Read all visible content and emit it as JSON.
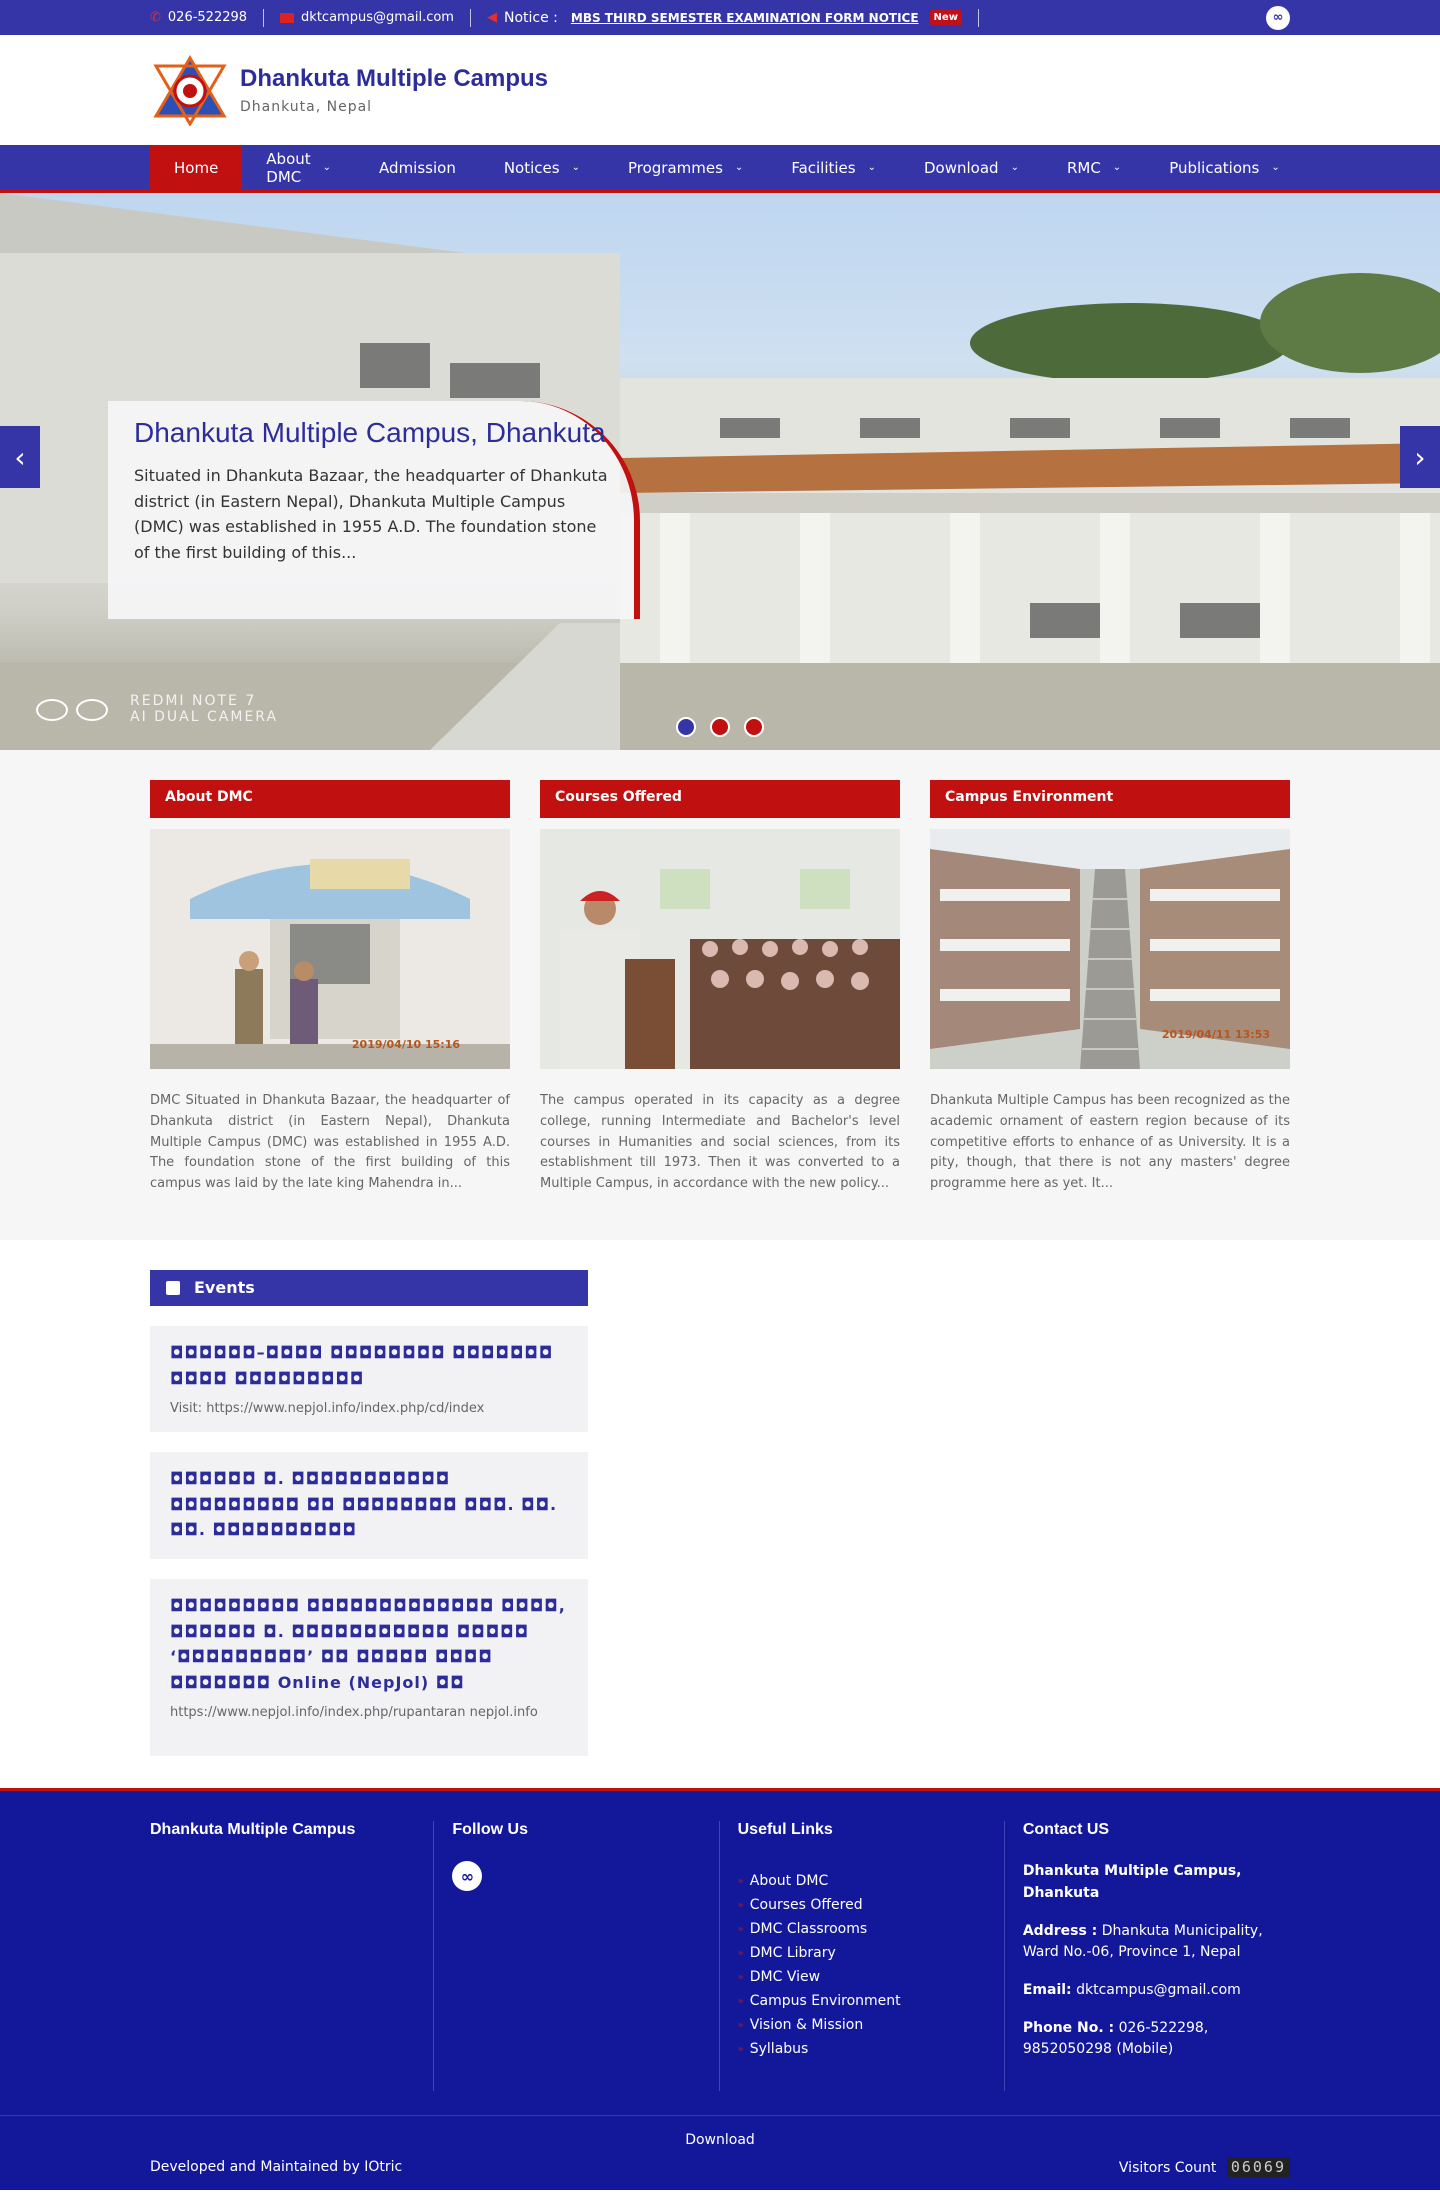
{
  "topbar": {
    "phone": "026-522298",
    "email": "dktcampus@gmail.com",
    "notice_label": "Notice :",
    "notice_text": "MBS THIRD SEMESTER EXAMINATION FORM NOTICE",
    "new_badge": "New"
  },
  "header": {
    "title": "Dhankuta Multiple Campus",
    "subtitle": "Dhankuta, Nepal"
  },
  "nav": {
    "items": [
      {
        "label": "Home"
      },
      {
        "label": "About DMC"
      },
      {
        "label": "Admission"
      },
      {
        "label": "Notices"
      },
      {
        "label": "Programmes"
      },
      {
        "label": "Facilities"
      },
      {
        "label": "Download"
      },
      {
        "label": "RMC"
      },
      {
        "label": "Publications"
      }
    ]
  },
  "slider": {
    "title": "Dhankuta Multiple Campus, Dhankuta",
    "text": "Situated in Dhankuta Bazaar, the headquarter of Dhankuta district (in Eastern Nepal), Dhankuta Multiple Campus (DMC) was established in 1955 A.D. The foundation stone of the first building of this...",
    "watermark_line1": "REDMI NOTE 7",
    "watermark_line2": "AI DUAL CAMERA"
  },
  "cards": [
    {
      "heading": "About DMC",
      "text": "DMC Situated in Dhankuta Bazaar, the headquarter of Dhankuta district (in Eastern Nepal), Dhankuta Multiple Campus (DMC) was established in 1955 A.D. The foundation stone of the first building of this campus was laid by the late king Mahendra in...",
      "stamp": "2019/04/10  15:16"
    },
    {
      "heading": "Courses Offered",
      "text": "The campus operated in its capacity as a degree college, running Intermediate and Bachelor's level courses in Humanities and social sciences, from its establishment till 1973. Then it was converted to a Multiple Campus, in accordance with the new policy...",
      "stamp": ""
    },
    {
      "heading": "Campus Environment",
      "text": "Dhankuta Multiple Campus has been recognized as the academic ornament of eastern region because of its competitive efforts to enhance of as University. It is a pity, though, that there is not any masters' degree programme here as yet. It...",
      "stamp": "2019/04/11  13:53"
    }
  ],
  "events": {
    "heading": "Events",
    "items": [
      {
        "title": "◘◘◘◘◘◘–◘◘◘◘ ◘◘◘◘◘◘◘◘ ◘◘◘◘◘◘◘ ◘◘◘◘ ◘◘◘◘◘◘◘◘◘",
        "text": "Visit: https://www.nepjol.info/index.php/cd/index"
      },
      {
        "title": "◘◘◘◘◘◘ ◘. ◘◘◘◘◘◘◘◘◘◘◘ ◘◘◘◘◘◘◘◘◘ ◘◘ ◘◘◘◘◘◘◘◘ ◘◘◘. ◘◘. ◘◘. ◘◘◘◘◘◘◘◘◘◘",
        "text": ""
      },
      {
        "title": "◘◘◘◘◘◘◘◘◘ ◘◘◘◘◘◘◘◘◘◘◘◘◘ ◘◘◘◘, ◘◘◘◘◘◘ ◘. ◘◘◘◘◘◘◘◘◘◘◘ ◘◘◘◘◘ ‘◘◘◘◘◘◘◘◘◘’ ◘◘ ◘◘◘◘◘ ◘◘◘◘ ◘◘◘◘◘◘◘ Online (NepJol) ◘◘",
        "text": "https://www.nepjol.info/index.php/rupantaran   nepjol.info"
      }
    ]
  },
  "footer": {
    "col1_head": "Dhankuta Multiple Campus",
    "col2_head": "Follow Us",
    "col3_head": "Useful Links",
    "col4_head": "Contact US",
    "links": [
      "About DMC",
      "Courses Offered",
      "DMC Classrooms",
      "DMC Library",
      "DMC View",
      "Campus Environment",
      "Vision & Mission",
      "Syllabus"
    ],
    "contact_name": "Dhankuta Multiple Campus, Dhankuta",
    "address_label": "Address :",
    "address_value": "Dhankuta Municipality, Ward No.-06, Province 1, Nepal",
    "email_label": "Email:",
    "email_value": "dktcampus@gmail.com",
    "phone_label": "Phone No. :",
    "phone_value": "026-522298, 9852050298 (Mobile)",
    "download": "Download",
    "developed": "Developed and Maintained by IOtric",
    "visitors_label": "Visitors Count",
    "visitors_count": "06069"
  },
  "colors": {
    "primary": "#3535a8",
    "accent": "#c01010",
    "footer": "#13189a"
  }
}
